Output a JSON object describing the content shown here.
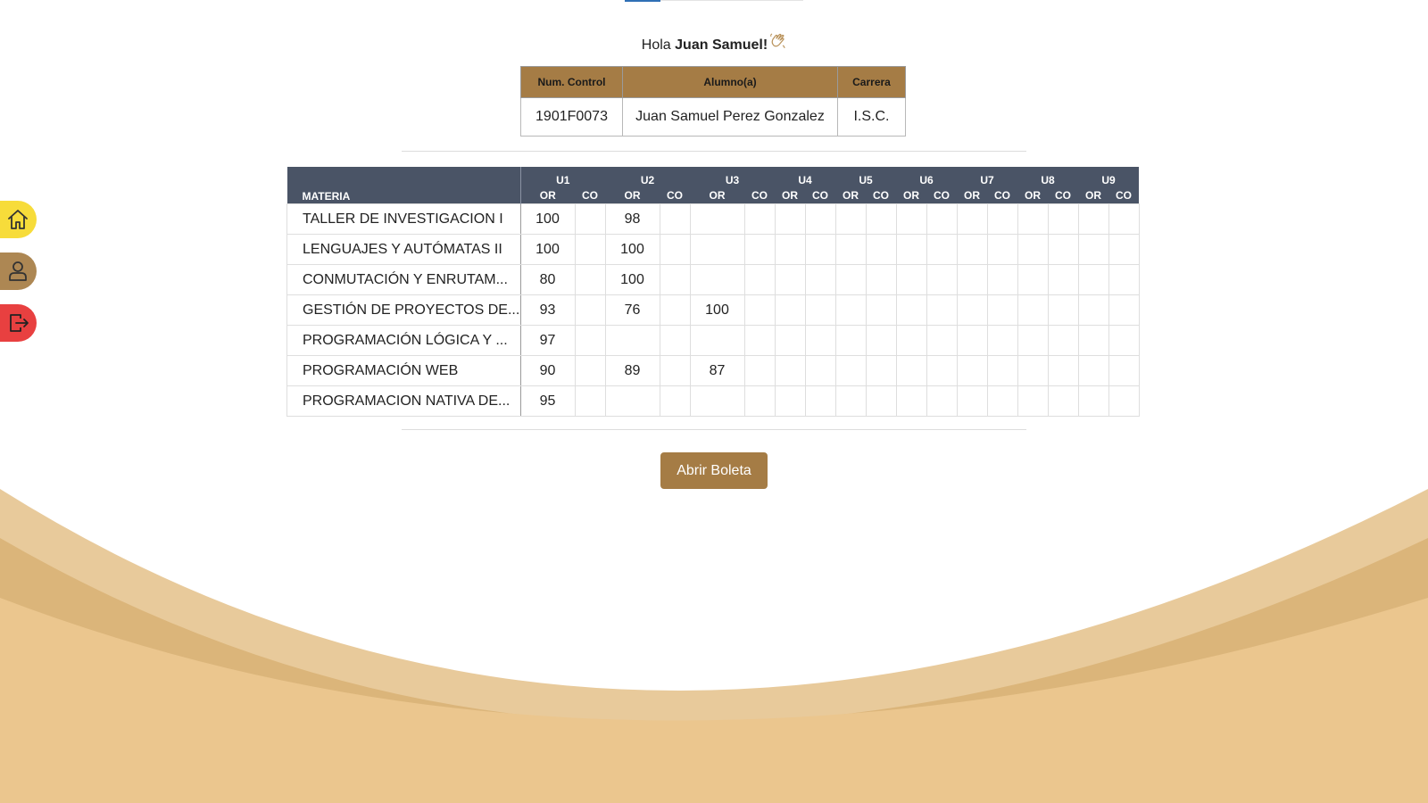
{
  "colors": {
    "accent_brown": "#a57c45",
    "header_slate": "#4a5466",
    "wave_light": "#e8ca9b",
    "wave_mid": "#dbb57a",
    "wave_base": "#ebc68e",
    "home_yellow": "#f7dc3a",
    "exit_red": "#e84040"
  },
  "sidebar": {
    "items": [
      {
        "icon": "home-icon"
      },
      {
        "icon": "user-icon"
      },
      {
        "icon": "logout-icon"
      }
    ]
  },
  "greeting": {
    "prefix": "Hola",
    "name": "Juan Samuel",
    "suffix": "!",
    "emoji_icon": "waving-hand-icon"
  },
  "student": {
    "headers": [
      "Num. Control",
      "Alumno(a)",
      "Carrera"
    ],
    "num_control": "1901F0073",
    "alumno": "Juan Samuel Perez Gonzalez",
    "carrera": "I.S.C."
  },
  "grades": {
    "materia_header": "MATERIA",
    "units": [
      "U1",
      "U2",
      "U3",
      "U4",
      "U5",
      "U6",
      "U7",
      "U8",
      "U9"
    ],
    "sub_or": "OR",
    "sub_co": "CO",
    "rows": [
      {
        "materia": "TALLER DE INVESTIGACION I",
        "cells": [
          "100",
          "",
          "98",
          "",
          "",
          "",
          "",
          "",
          "",
          "",
          "",
          "",
          "",
          "",
          "",
          "",
          "",
          ""
        ]
      },
      {
        "materia": "LENGUAJES Y AUTÓMATAS II",
        "cells": [
          "100",
          "",
          "100",
          "",
          "",
          "",
          "",
          "",
          "",
          "",
          "",
          "",
          "",
          "",
          "",
          "",
          "",
          ""
        ]
      },
      {
        "materia": "CONMUTACIÓN Y ENRUTAM...",
        "cells": [
          "80",
          "",
          "100",
          "",
          "",
          "",
          "",
          "",
          "",
          "",
          "",
          "",
          "",
          "",
          "",
          "",
          "",
          ""
        ]
      },
      {
        "materia": "GESTIÓN DE PROYECTOS DE...",
        "cells": [
          "93",
          "",
          "76",
          "",
          "100",
          "",
          "",
          "",
          "",
          "",
          "",
          "",
          "",
          "",
          "",
          "",
          "",
          ""
        ]
      },
      {
        "materia": "PROGRAMACIÓN LÓGICA Y ...",
        "cells": [
          "97",
          "",
          "",
          "",
          "",
          "",
          "",
          "",
          "",
          "",
          "",
          "",
          "",
          "",
          "",
          "",
          "",
          ""
        ]
      },
      {
        "materia": "PROGRAMACIÓN WEB",
        "cells": [
          "90",
          "",
          "89",
          "",
          "87",
          "",
          "",
          "",
          "",
          "",
          "",
          "",
          "",
          "",
          "",
          "",
          "",
          ""
        ]
      },
      {
        "materia": "PROGRAMACION NATIVA DE...",
        "cells": [
          "95",
          "",
          "",
          "",
          "",
          "",
          "",
          "",
          "",
          "",
          "",
          "",
          "",
          "",
          "",
          "",
          "",
          ""
        ]
      }
    ]
  },
  "actions": {
    "open_boleta_label": "Abrir Boleta"
  }
}
